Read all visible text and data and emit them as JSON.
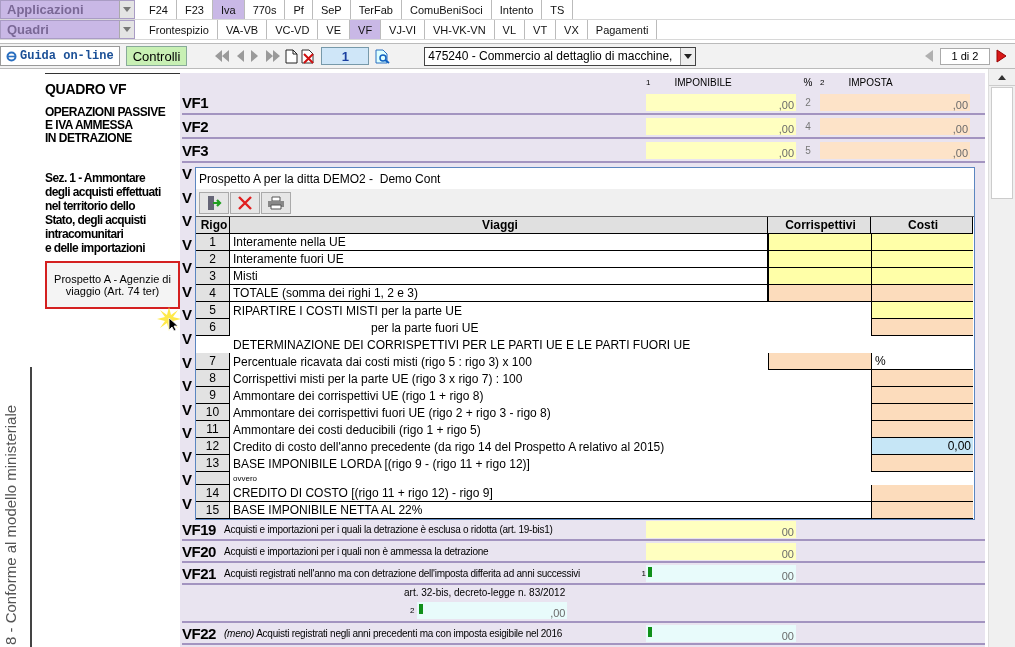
{
  "applications": {
    "label": "Applicazioni",
    "tabs": [
      {
        "label": "F24",
        "selected": false
      },
      {
        "label": "F23",
        "selected": false
      },
      {
        "label": "Iva",
        "selected": true
      },
      {
        "label": "770s",
        "selected": false
      },
      {
        "label": "Pf",
        "selected": false
      },
      {
        "label": "SeP",
        "selected": false
      },
      {
        "label": "TerFab",
        "selected": false
      },
      {
        "label": "ComuBeniSoci",
        "selected": false
      },
      {
        "label": "Intento",
        "selected": false
      },
      {
        "label": "TS",
        "selected": false
      }
    ]
  },
  "quadri": {
    "label": "Quadri",
    "tabs": [
      {
        "label": "Frontespizio",
        "selected": false
      },
      {
        "label": "VA-VB",
        "selected": false
      },
      {
        "label": "VC-VD",
        "selected": false
      },
      {
        "label": "VE",
        "selected": false
      },
      {
        "label": "VF",
        "selected": true
      },
      {
        "label": "VJ-VI",
        "selected": false
      },
      {
        "label": "VH-VK-VN",
        "selected": false
      },
      {
        "label": "VL",
        "selected": false
      },
      {
        "label": "VT",
        "selected": false
      },
      {
        "label": "VX",
        "selected": false
      },
      {
        "label": "Pagamenti",
        "selected": false
      }
    ]
  },
  "toolbar": {
    "help_button": "Guida on-line",
    "check_button": "Controlli",
    "page": "1",
    "company": "475240 - Commercio al dettaglio di macchine,",
    "page_count": "1 di 2"
  },
  "side_label": "8 - Conforme al modello ministeriale",
  "quadro": {
    "title": "QUADRO VF",
    "subtitle_lines": [
      "OPERAZIONI PASSIVE",
      "E IVA AMMESSA",
      "IN DETRAZIONE"
    ],
    "section_lines": [
      "Sez. 1 - Ammontare",
      "degli acquisti effettuati",
      "nel territorio dello",
      "Stato, degli acquisti",
      "intracomunitari",
      "e delle importazioni"
    ],
    "button": "Prospetto A - Agenzie di viaggio (Art. 74 ter)"
  },
  "form": {
    "header": {
      "imponibile_number": "1",
      "imponibile": "IMPONIBILE",
      "percent": "%",
      "imposta_number": "2",
      "imposta": "IMPOSTA"
    },
    "rows": [
      {
        "kind": "pair",
        "label": "VF1",
        "imponibile": {
          "value": ",00",
          "color": "#ffffc0",
          "marked": false
        },
        "number": "2",
        "imposta": {
          "value": ",00",
          "color": "#fde3c8",
          "marked": false
        }
      },
      {
        "kind": "pair",
        "label": "VF2",
        "imponibile": {
          "value": ",00",
          "color": "#ffffc0",
          "marked": false
        },
        "number": "4",
        "imposta": {
          "value": ",00",
          "color": "#fde3c8",
          "marked": false
        }
      },
      {
        "kind": "pair",
        "label": "VF3",
        "imponibile": {
          "value": ",00",
          "color": "#ffffc0",
          "marked": false
        },
        "number": "5",
        "imposta": {
          "value": ",00",
          "color": "#fde3c8",
          "marked": false
        }
      },
      {
        "kind": "covered",
        "label": "V"
      },
      {
        "kind": "covered",
        "label": "V"
      },
      {
        "kind": "covered",
        "label": "V"
      },
      {
        "kind": "covered",
        "label": "V"
      },
      {
        "kind": "covered",
        "label": "V"
      },
      {
        "kind": "covered",
        "label": "V"
      },
      {
        "kind": "covered",
        "label": "V"
      },
      {
        "kind": "covered",
        "label": "V"
      },
      {
        "kind": "covered",
        "label": "V"
      },
      {
        "kind": "covered",
        "label": "V"
      },
      {
        "kind": "covered",
        "label": "V"
      },
      {
        "kind": "covered",
        "label": "V"
      },
      {
        "kind": "covered",
        "label": "V"
      },
      {
        "kind": "covered",
        "label": "V"
      },
      {
        "kind": "covered",
        "label": "V"
      },
      {
        "kind": "single",
        "label": "VF19",
        "text": "Acquisti e importazioni per i quali la detrazione è esclusa o ridotta (art. 19-bis1)",
        "field": {
          "value": "00",
          "color": "#ffffc0",
          "marked": false
        }
      },
      {
        "kind": "single",
        "label": "VF20",
        "text": "Acquisti e importazioni per i quali non è ammessa la detrazione",
        "field": {
          "value": "00",
          "color": "#ffffc0",
          "marked": false
        }
      },
      {
        "kind": "single",
        "label": "VF21",
        "text": "Acquisti registrati nell'anno ma con detrazione dell'imposta differita ad anni successivi",
        "number": "1",
        "field": {
          "value": "00",
          "color": "#e8fbfb",
          "marked": true
        }
      },
      {
        "kind": "sub",
        "text": "art. 32-bis, decreto-legge n. 83/2012",
        "number": "2",
        "field": {
          "value": ",00",
          "color": "#e8fbfb",
          "marked": true
        }
      },
      {
        "kind": "single",
        "label": "VF22",
        "text": "*(meno)* Acquisti registrati negli anni precedenti ma con imposta esigibile nel 2016",
        "field": {
          "value": "00",
          "color": "#e8fbfb",
          "marked": true
        }
      }
    ]
  },
  "dialog": {
    "title": "Prospetto A per la ditta DEMO2 -  Demo Cont",
    "columns": [
      "Rigo",
      "Viaggi",
      "Corrispettivi",
      "Costi"
    ],
    "rows": [
      {
        "kind": "entry",
        "rigo": "1",
        "label": "Interamente nella UE",
        "corrispettivi": {
          "color": "#ffffa8"
        },
        "costi": {
          "color": "#ffffa8"
        }
      },
      {
        "kind": "entry",
        "rigo": "2",
        "label": "Interamente fuori UE",
        "corrispettivi": {
          "color": "#ffffa8"
        },
        "costi": {
          "color": "#ffffa8"
        }
      },
      {
        "kind": "entry",
        "rigo": "3",
        "label": "Misti",
        "corrispettivi": {
          "color": "#ffffa8"
        },
        "costi": {
          "color": "#ffffa8"
        }
      },
      {
        "kind": "entry",
        "rigo": "4",
        "label": "TOTALE (somma dei righi 1, 2 e 3)",
        "corrispettivi": {
          "color": "#fcdcbc"
        },
        "costi": {
          "color": "#fcdcbc"
        }
      },
      {
        "kind": "line",
        "rigo": "5",
        "label": "RIPARTIRE I COSTI MISTI per la parte UE",
        "costi": {
          "color": "#ffffa8"
        }
      },
      {
        "kind": "continuation",
        "rigo": "6",
        "label": "per la parte fuori UE",
        "costi": {
          "color": "#fcdcbc"
        }
      },
      {
        "kind": "heading",
        "label": "DETERMINAZIONE DEI CORRISPETTIVI PER LE PARTI UE E LE PARTI FUORI UE"
      },
      {
        "kind": "line",
        "rigo": "7",
        "label": "Percentuale ricavata dai costi misti (rigo 5 : rigo 3) x 100",
        "corrispettivi": {
          "color": "#fcdcbc"
        },
        "costi": {
          "value": "%"
        }
      },
      {
        "kind": "line",
        "rigo": "8",
        "label": "Corrispettivi misti per la parte UE (rigo 3 x rigo 7) : 100",
        "costi": {
          "color": "#fcdcbc"
        }
      },
      {
        "kind": "line",
        "rigo": "9",
        "label": "Ammontare dei corrispettivi UE (rigo 1 + rigo 8)",
        "costi": {
          "color": "#fcdcbc"
        }
      },
      {
        "kind": "line",
        "rigo": "10",
        "label": "Ammontare dei corrispettivi fuori UE (rigo 2 + rigo 3 - rigo 8)",
        "costi": {
          "color": "#fcdcbc"
        }
      },
      {
        "kind": "line",
        "rigo": "11",
        "label": "Ammontare dei costi deducibili (rigo 1 + rigo 5)",
        "costi": {
          "color": "#fcdcbc"
        }
      },
      {
        "kind": "line",
        "rigo": "12",
        "label": "Credito di costo dell'anno precedente (da rigo 14 del Prospetto A relativo al 2015)",
        "costi": {
          "color": "#c6e6f6",
          "value": "0,00"
        }
      },
      {
        "kind": "line",
        "rigo": "13",
        "label": "BASE IMPONIBILE LORDA [(rigo 9 - (rigo 11 + rigo 12)]",
        "costi": {
          "color": "#fcdcbc"
        }
      },
      {
        "kind": "note",
        "label": "ovvero"
      },
      {
        "kind": "line",
        "rigo": "14",
        "label": "CREDITO DI COSTO [(rigo 11 + rigo 12) - rigo 9]",
        "costi": {
          "color": "#fcdcbc"
        }
      },
      {
        "kind": "line",
        "rigo": "15",
        "label": "BASE IMPONIBILE NETTA AL 22%",
        "costi": {
          "color": "#fcdcbc"
        }
      }
    ]
  }
}
